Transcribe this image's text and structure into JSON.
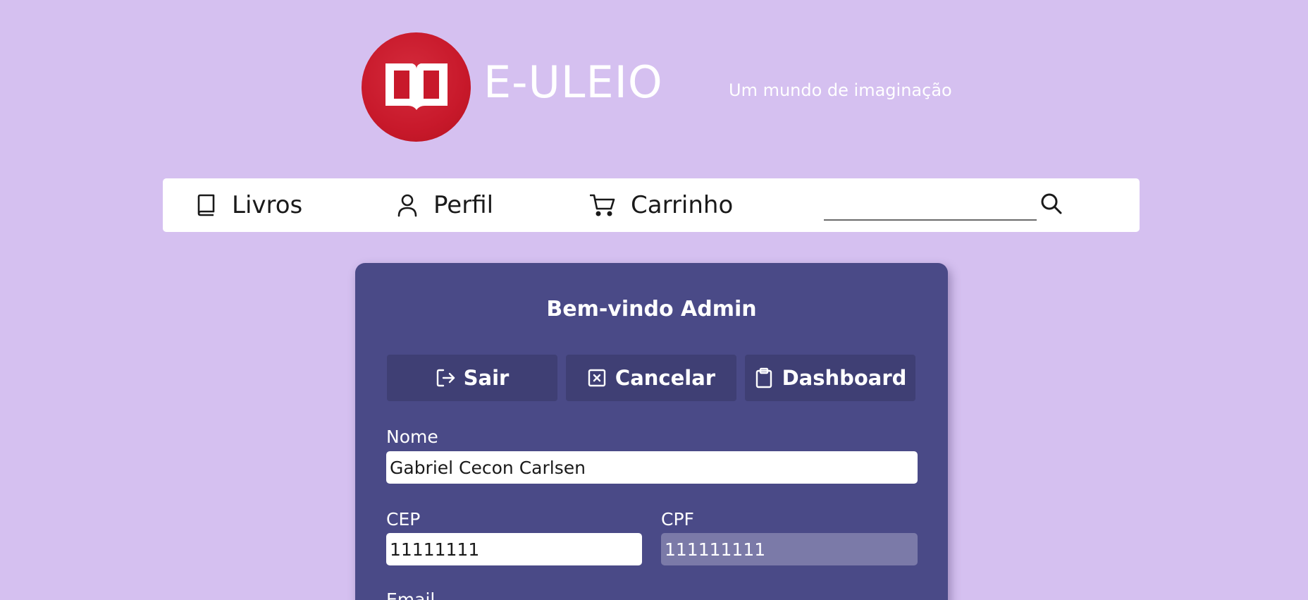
{
  "header": {
    "logo_text": "E-ULEIO",
    "tagline": "Um mundo de imaginação",
    "logo_icon": "open-book-icon",
    "logo_color": "#c8192b"
  },
  "nav": {
    "items": [
      {
        "label": "Livros",
        "icon": "book-icon"
      },
      {
        "label": "Perfil",
        "icon": "user-icon"
      },
      {
        "label": "Carrinho",
        "icon": "cart-icon"
      }
    ],
    "search": {
      "value": "",
      "placeholder": "",
      "icon": "search-icon"
    }
  },
  "card": {
    "title": "Bem-vindo Admin",
    "buttons": [
      {
        "label": "Sair",
        "icon": "logout-icon"
      },
      {
        "label": "Cancelar",
        "icon": "close-square-icon"
      },
      {
        "label": "Dashboard",
        "icon": "clipboard-icon"
      }
    ],
    "fields": {
      "nome": {
        "label": "Nome",
        "value": "Gabriel Cecon Carlsen"
      },
      "cep": {
        "label": "CEP",
        "value": "11111111"
      },
      "cpf": {
        "label": "CPF",
        "value": "111111111",
        "disabled": true
      },
      "email": {
        "label": "Email"
      }
    }
  },
  "colors": {
    "background": "#d5c0f0",
    "card": "#4a4a87",
    "button": "#3f3f74",
    "disabled_input": "#7b7aa8"
  }
}
